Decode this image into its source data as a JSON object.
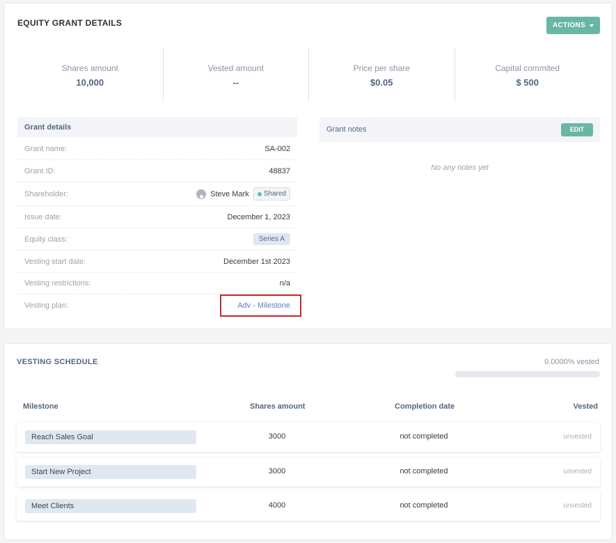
{
  "grant": {
    "title": "EQUITY GRANT DETAILS",
    "actions_label": "ACTIONS",
    "stats": [
      {
        "label": "Shares amount",
        "value": "10,000"
      },
      {
        "label": "Vested amount",
        "value": "--"
      },
      {
        "label": "Price per share",
        "value": "$0.05"
      },
      {
        "label": "Capital commited",
        "value": "$ 500"
      }
    ],
    "details": {
      "title": "Grant details",
      "rows": [
        {
          "label": "Grant name:",
          "value": "SA-002"
        },
        {
          "label": "Grant ID:",
          "value": "48837"
        },
        {
          "label": "Shareholder:",
          "value": "Steve Mark",
          "badge": "Shared"
        },
        {
          "label": "Issue date:",
          "value": "December 1, 2023"
        },
        {
          "label": "Equity class:",
          "value": "Series A"
        },
        {
          "label": "Vesting start date:",
          "value": "December 1st 2023"
        },
        {
          "label": "Vesting restrictions:",
          "value": "n/a"
        },
        {
          "label": "Vesting plan:",
          "value": "Adv - Milestone"
        }
      ]
    },
    "notes": {
      "title": "Grant notes",
      "edit_label": "EDIT",
      "empty_text": "No any notes yet"
    }
  },
  "vesting": {
    "title": "VESTING SCHEDULE",
    "vested_percent_text": "0.0000% vested",
    "progress_fraction": 0,
    "columns": [
      "Milestone",
      "Shares amount",
      "Completion date",
      "Vested"
    ],
    "rows": [
      {
        "milestone": "Reach Sales Goal",
        "shares": "3000",
        "completion": "not completed",
        "vested": "unvested"
      },
      {
        "milestone": "Start New Project",
        "shares": "3000",
        "completion": "not completed",
        "vested": "unvested"
      },
      {
        "milestone": "Meet Clients",
        "shares": "4000",
        "completion": "not completed",
        "vested": "unvested"
      }
    ]
  },
  "colors": {
    "accent": "#6ab6a5",
    "link": "#5a7fc4",
    "highlight": "#c62828"
  }
}
